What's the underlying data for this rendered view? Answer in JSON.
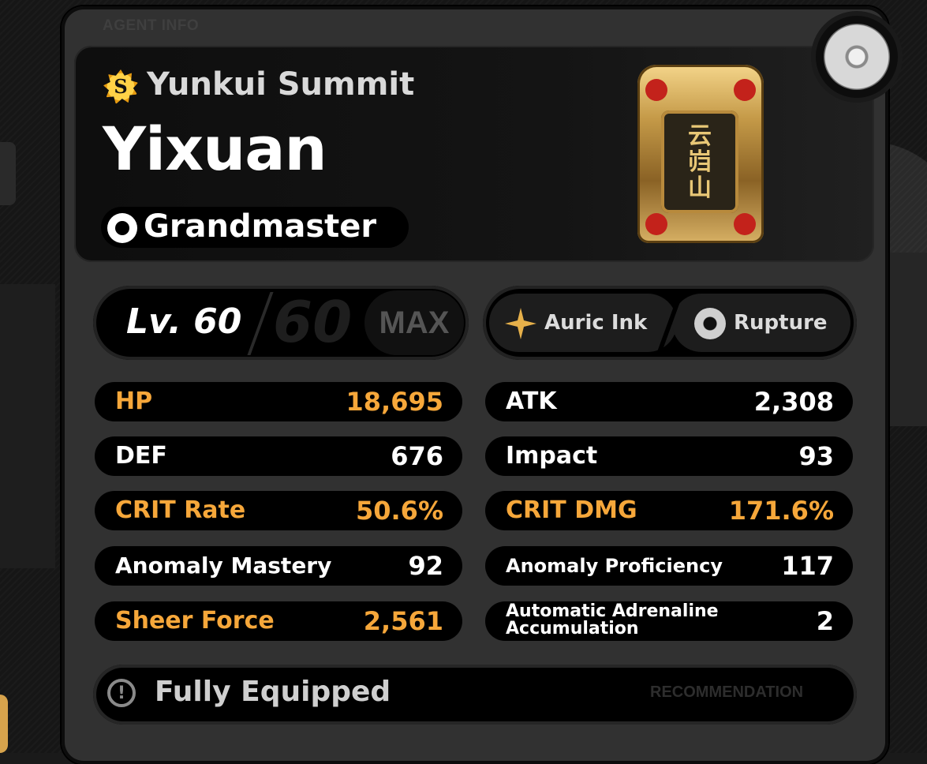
{
  "section_label": "AGENT INFO",
  "faction": {
    "name": "Yunkui Summit",
    "icon": "s-emblem-icon"
  },
  "agent": {
    "name": "Yixuan"
  },
  "rank": {
    "label": "Grandmaster",
    "icon": "rank-q-icon"
  },
  "level": {
    "prefix_label": "Lv. 60",
    "max_level": "60",
    "max_badge": "MAX"
  },
  "attributes": [
    {
      "label": "Auric Ink",
      "icon": "auric-ink-icon"
    },
    {
      "label": "Rupture",
      "icon": "rupture-icon"
    }
  ],
  "stats": [
    {
      "label": "HP",
      "value": "18,695",
      "highlight": true
    },
    {
      "label": "ATK",
      "value": "2,308",
      "highlight": false
    },
    {
      "label": "DEF",
      "value": "676",
      "highlight": false
    },
    {
      "label": "Impact",
      "value": "93",
      "highlight": false
    },
    {
      "label": "CRIT Rate",
      "value": "50.6%",
      "highlight": true
    },
    {
      "label": "CRIT DMG",
      "value": "171.6%",
      "highlight": true
    },
    {
      "label": "Anomaly Mastery",
      "value": "92",
      "highlight": false
    },
    {
      "label": "Anomaly Proficiency",
      "value": "117",
      "highlight": false
    },
    {
      "label": "Sheer Force",
      "value": "2,561",
      "highlight": true
    },
    {
      "label_line1": "Automatic Adrenaline",
      "label_line2": "Accumulation",
      "value": "2",
      "highlight": false
    }
  ],
  "footer": {
    "status": "Fully Equipped",
    "recommendation": "RECOMMENDATION",
    "icon": "exclamation-icon"
  },
  "colors": {
    "highlight": "#f6a73a",
    "panel": "#313131",
    "pill": "#000000"
  }
}
